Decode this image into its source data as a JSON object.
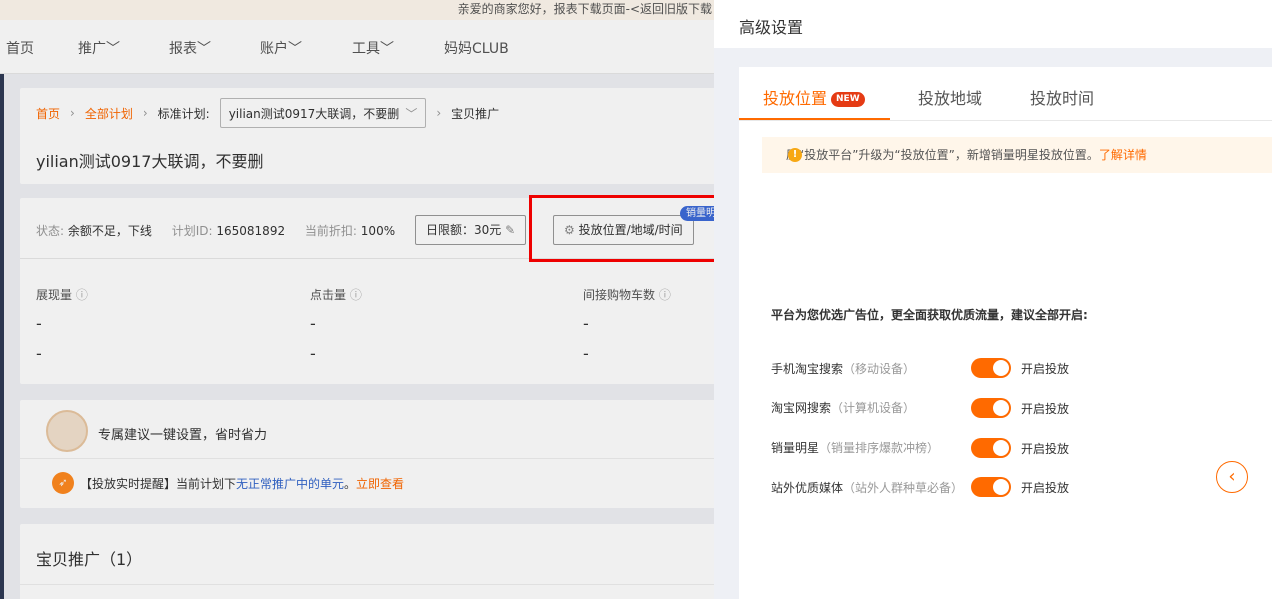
{
  "notice": "亲爱的商家您好，报表下载页面-<返回旧版下载",
  "nav": [
    "首页",
    "推广﹀",
    "报表﹀",
    "账户﹀",
    "工具﹀",
    "妈妈CLUB"
  ],
  "breadcrumb": {
    "home": "首页",
    "all_plans": "全部计划",
    "standard_plan": "标准计划:",
    "plan_select": "yilian测试0917大联调，不要删",
    "current": "宝贝推广"
  },
  "plan_title": "yilian测试0917大联调，不要删",
  "status": {
    "status_label": "状态:",
    "status_value": "余额不足，下线",
    "plan_id_label": "计划ID:",
    "plan_id_value": "165081892",
    "discount_label": "当前折扣:",
    "discount_value": "100%",
    "daily_limit": "日限额：30元",
    "placement_button": "投放位置/地域/时间",
    "badge": "销量明"
  },
  "metrics": [
    {
      "label": "展现量",
      "v1": "-",
      "v2": "-"
    },
    {
      "label": "点击量",
      "v1": "-",
      "v2": "-"
    },
    {
      "label": "间接购物车数",
      "v1": "-",
      "v2": "-"
    }
  ],
  "suggestion": "专属建议一键设置，省时省力",
  "reminder": {
    "prefix": "【投放实时提醒】当前计划下",
    "link": "无正常推广中的单元",
    "dot": "。",
    "action": "立即查看"
  },
  "product_section": "宝贝推广（1）",
  "panel": {
    "title": "高级设置",
    "tabs": [
      "投放位置",
      "投放地域",
      "投放时间"
    ],
    "new_badge": "NEW",
    "alert_text": "原“投放平台”升级为“投放位置”，新增销量明星投放位置。",
    "alert_link": "了解详情",
    "intro": "平台为您优选广告位，更全面获取优质流量，建议全部开启:",
    "options": [
      {
        "name": "手机淘宝搜索",
        "sub": "（移动设备）",
        "state": "开启投放",
        "on": true
      },
      {
        "name": "淘宝网搜索",
        "sub": "（计算机设备）",
        "state": "开启投放",
        "on": true
      },
      {
        "name": "销量明星",
        "sub": "（销量排序爆款冲榜）",
        "state": "开启投放",
        "on": true
      },
      {
        "name": "站外优质媒体",
        "sub": "（站外人群种草必备）",
        "state": "开启投放",
        "on": true
      }
    ]
  },
  "colors": {
    "accent": "#ff6a00",
    "highlight": "#ee0000",
    "badge": "#3d6bd9"
  }
}
